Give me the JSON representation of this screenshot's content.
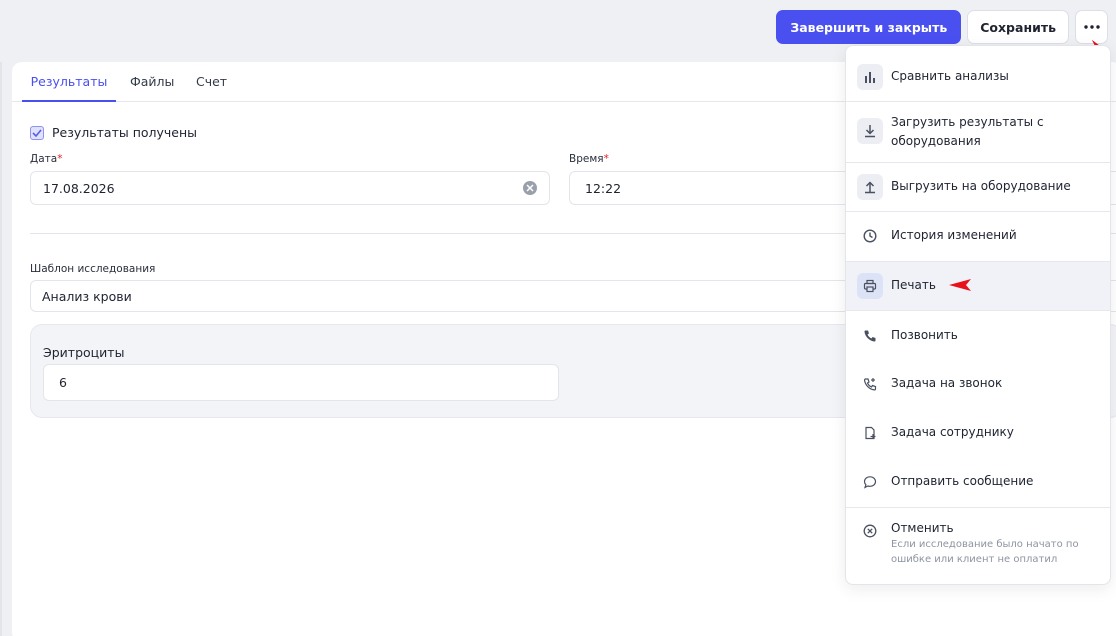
{
  "toolbar": {
    "finish_label": "Завершить и закрыть",
    "save_label": "Сохранить"
  },
  "tabs": [
    {
      "label": "Результаты",
      "active": true
    },
    {
      "label": "Файлы",
      "active": false
    },
    {
      "label": "Счет",
      "active": false
    }
  ],
  "form": {
    "results_received_label": "Результаты получены",
    "results_received_checked": true,
    "date_label": "Дата",
    "date_value": "17.08.2026",
    "time_label": "Время",
    "time_value": "12:22",
    "required_mark": "*",
    "template_label": "Шаблон исследования",
    "template_value": "Анализ крови",
    "erythrocytes_label": "Эритроциты",
    "erythrocytes_value": "6"
  },
  "menu": {
    "items": [
      {
        "label": "Сравнить анализы",
        "icon": "bar-chart-icon"
      },
      {
        "label": "Загрузить результаты с",
        "label2": "оборудования",
        "icon": "download-icon"
      },
      {
        "label": "Выгрузить на оборудование",
        "icon": "upload-icon"
      },
      {
        "label": "История изменений",
        "icon": "clock-icon"
      },
      {
        "label": "Печать",
        "icon": "printer-icon",
        "highlight": true
      },
      {
        "label": "Позвонить",
        "icon": "phone-icon"
      },
      {
        "label": "Задача на звонок",
        "icon": "phone-task-icon"
      },
      {
        "label": "Задача сотруднику",
        "icon": "file-task-icon"
      },
      {
        "label": "Отправить сообщение",
        "icon": "message-icon"
      },
      {
        "label": "Отменить",
        "icon": "cancel-circle-icon",
        "sub1": "Если исследование было начато по",
        "sub2": "ошибке или клиент не оплатил"
      }
    ]
  },
  "colors": {
    "primary": "#4a4ff0",
    "annotation_arrow": "#e8111b",
    "required": "#e02424"
  }
}
